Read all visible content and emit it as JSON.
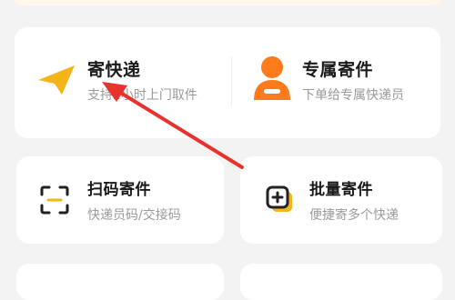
{
  "service_card": {
    "send_express": {
      "title": "寄快递",
      "subtitle": "支持2小时上门取件",
      "icon": "paper-plane-icon"
    },
    "dedicated_send": {
      "title": "专属寄件",
      "subtitle": "下单给专属快递员",
      "icon": "courier-person-icon"
    }
  },
  "tools": {
    "scan_send": {
      "title": "扫码寄件",
      "subtitle": "快递员码/交接码",
      "icon": "scan-frame-icon"
    },
    "batch_send": {
      "title": "批量寄件",
      "subtitle": "便捷寄多个快递",
      "icon": "batch-add-icon"
    }
  },
  "colors": {
    "plane_yellow": "#f5b417",
    "person_orange": "#ff7a1a",
    "arrow_red": "#e8322e"
  }
}
